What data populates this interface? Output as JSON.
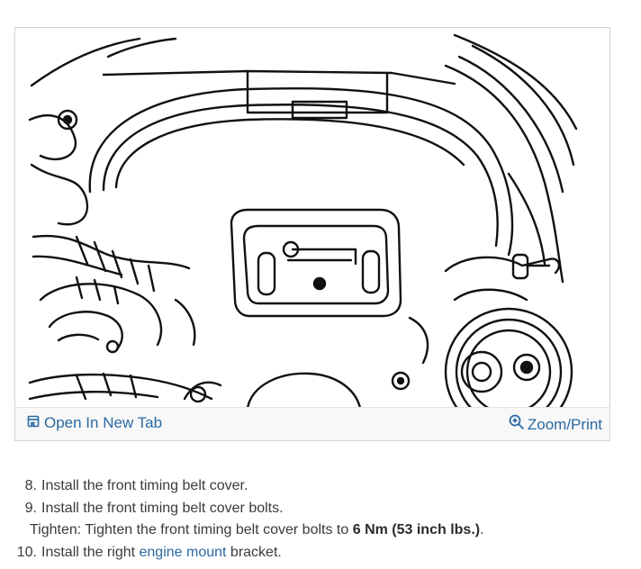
{
  "figure": {
    "open_tab_label": "Open In New Tab",
    "open_tab_icon": "open-in-new-tab-icon",
    "zoom_label": "Zoom/Print",
    "zoom_icon": "magnifier-icon",
    "link_color": "#2a6aa3"
  },
  "steps": [
    {
      "number": "8.",
      "text": "Install the front timing belt cover."
    },
    {
      "number": "9.",
      "text": "Install the front timing belt cover bolts."
    },
    {
      "tighten": {
        "prefix": "Tighten: Tighten the front timing belt cover bolts to ",
        "torque": "6 Nm (53 inch lbs.)",
        "suffix": "."
      }
    },
    {
      "number": "10.",
      "before": "Install the right ",
      "link": "engine mount",
      "after": " bracket."
    }
  ]
}
